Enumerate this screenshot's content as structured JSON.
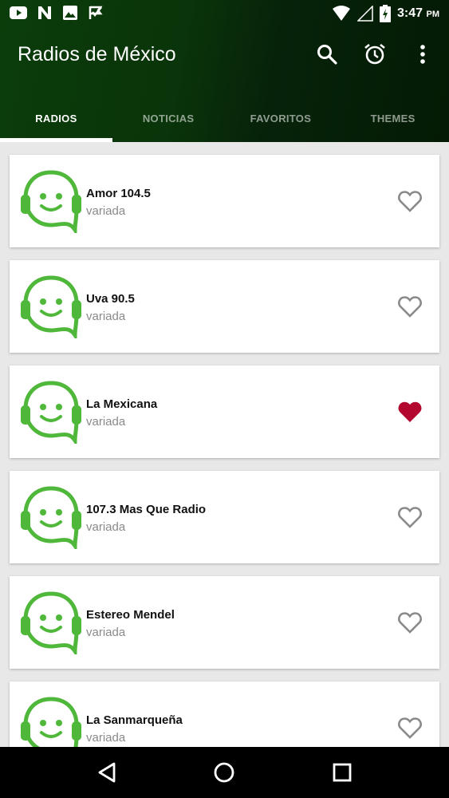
{
  "status_bar": {
    "time": "3:47",
    "ampm": "PM"
  },
  "app": {
    "title": "Radios de México"
  },
  "tabs": [
    {
      "label": "RADIOS",
      "active": true
    },
    {
      "label": "NOTICIAS",
      "active": false
    },
    {
      "label": "FAVORITOS",
      "active": false
    },
    {
      "label": "THEMES",
      "active": false
    }
  ],
  "stations": [
    {
      "name": "Amor 104.5",
      "genre": "variada",
      "favorite": false
    },
    {
      "name": "Uva 90.5",
      "genre": "variada",
      "favorite": false
    },
    {
      "name": "La Mexicana",
      "genre": "variada",
      "favorite": true
    },
    {
      "name": "107.3 Mas Que Radio",
      "genre": "variada",
      "favorite": false
    },
    {
      "name": "Estereo Mendel",
      "genre": "variada",
      "favorite": false
    },
    {
      "name": "La Sanmarqueña",
      "genre": "variada",
      "favorite": false
    }
  ],
  "colors": {
    "header_green": "#0b3d0b",
    "logo_green": "#4fb83a",
    "favorite_red": "#b3072f",
    "heart_outline": "#8a8a8a"
  }
}
